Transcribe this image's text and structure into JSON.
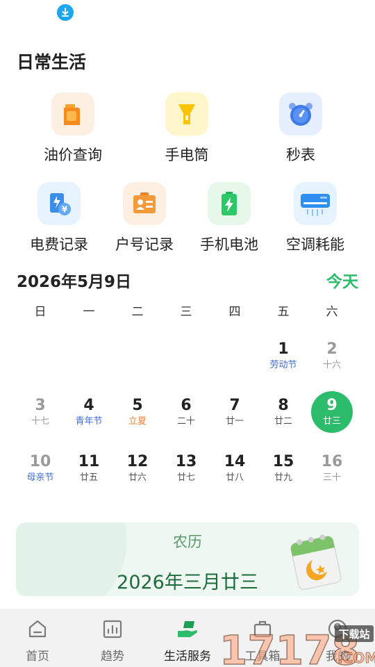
{
  "section_title": "日常生活",
  "tools": [
    {
      "label": "油价查询",
      "icon": "oil-can-icon",
      "tile_color": "#fdf0e2"
    },
    {
      "label": "手电筒",
      "icon": "flashlight-icon",
      "tile_color": "#fff6cc"
    },
    {
      "label": "秒表",
      "icon": "alarm-clock-icon",
      "tile_color": "#e6efff"
    },
    {
      "label": "电费记录",
      "icon": "electric-bill-icon",
      "tile_color": "#e6f3ff"
    },
    {
      "label": "户号记录",
      "icon": "id-card-icon",
      "tile_color": "#fdf0e2"
    },
    {
      "label": "手机电池",
      "icon": "battery-icon",
      "tile_color": "#e6f8ea"
    },
    {
      "label": "空调耗能",
      "icon": "air-conditioner-icon",
      "tile_color": "#e6f3ff"
    }
  ],
  "calendar": {
    "title": "2026年5月9日",
    "today_label": "今天",
    "weekdays": [
      "日",
      "一",
      "二",
      "三",
      "四",
      "五",
      "六"
    ],
    "weeks": [
      [
        null,
        null,
        null,
        null,
        null,
        {
          "day": "1",
          "sub": "劳动节",
          "type": "holiday"
        },
        {
          "day": "2",
          "sub": "十六",
          "type": "dim"
        }
      ],
      [
        {
          "day": "3",
          "sub": "十七",
          "type": "dim"
        },
        {
          "day": "4",
          "sub": "青年节",
          "type": "holiday"
        },
        {
          "day": "5",
          "sub": "立夏",
          "type": "term"
        },
        {
          "day": "6",
          "sub": "二十",
          "type": "normal"
        },
        {
          "day": "7",
          "sub": "廿一",
          "type": "normal"
        },
        {
          "day": "8",
          "sub": "廿二",
          "type": "normal"
        },
        {
          "day": "9",
          "sub": "廿三",
          "type": "selected"
        }
      ],
      [
        {
          "day": "10",
          "sub": "母亲节",
          "type": "dim-holiday"
        },
        {
          "day": "11",
          "sub": "廿五",
          "type": "normal"
        },
        {
          "day": "12",
          "sub": "廿六",
          "type": "normal"
        },
        {
          "day": "13",
          "sub": "廿七",
          "type": "normal"
        },
        {
          "day": "14",
          "sub": "廿八",
          "type": "normal"
        },
        {
          "day": "15",
          "sub": "廿九",
          "type": "normal"
        },
        {
          "day": "16",
          "sub": "三十",
          "type": "dim"
        }
      ]
    ]
  },
  "lunar": {
    "label": "农历",
    "date": "2026年三月廿三"
  },
  "nav": [
    {
      "label": "首页",
      "icon": "home-icon",
      "active": false
    },
    {
      "label": "趋势",
      "icon": "trend-chart-icon",
      "active": false
    },
    {
      "label": "生活服务",
      "icon": "life-service-icon",
      "active": true
    },
    {
      "label": "工具箱",
      "icon": "toolbox-icon",
      "active": false
    },
    {
      "label": "我的",
      "icon": "profile-icon",
      "active": false
    }
  ],
  "watermark": {
    "brand": "17178",
    "tag": "下载站",
    "suffix": ".COM"
  },
  "colors": {
    "accent": "#2dbb6c",
    "holiday": "#3f6cd2",
    "solar_term": "#f0833a",
    "dim": "#9a9a9a"
  }
}
